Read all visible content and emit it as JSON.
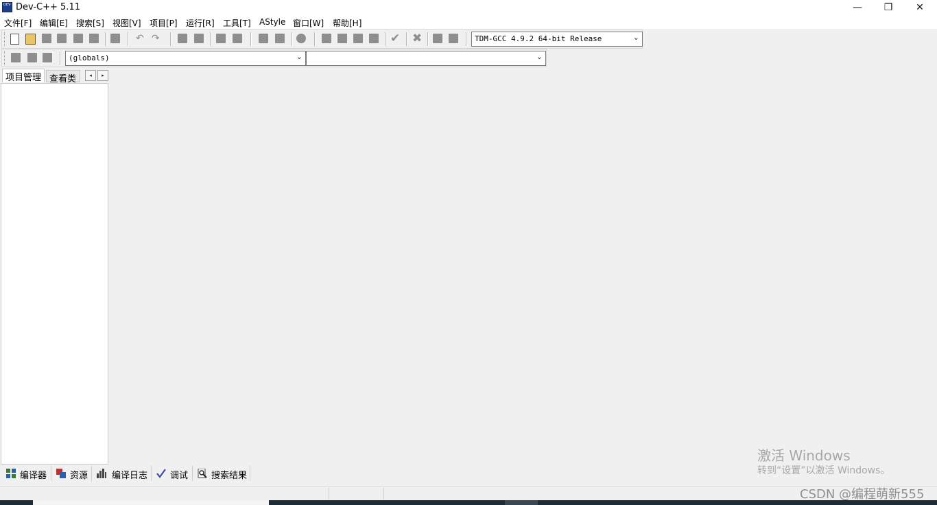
{
  "window": {
    "title": "Dev-C++ 5.11",
    "icon_label": "DEV",
    "minimize_glyph": "—",
    "restore_glyph": "❐",
    "close_glyph": "✕"
  },
  "menu": [
    {
      "label": "文件[F]"
    },
    {
      "label": "编辑[E]"
    },
    {
      "label": "搜索[S]"
    },
    {
      "label": "视图[V]"
    },
    {
      "label": "项目[P]"
    },
    {
      "label": "运行[R]"
    },
    {
      "label": "工具[T]"
    },
    {
      "label": "AStyle"
    },
    {
      "label": "窗口[W]"
    },
    {
      "label": "帮助[H]"
    }
  ],
  "toolbar": {
    "compiler_select": "TDM-GCC 4.9.2 64-bit Release",
    "scope_select": "(globals)",
    "function_select": ""
  },
  "left_panel": {
    "tabs": [
      "项目管理",
      "查看类"
    ],
    "scroll_left": "◂",
    "scroll_right": "▸"
  },
  "bottom_tabs": [
    {
      "label": "编译器",
      "icon": "compiler-grid-icon"
    },
    {
      "label": "资源",
      "icon": "resources-icon"
    },
    {
      "label": "编译日志",
      "icon": "bar-chart-icon"
    },
    {
      "label": "调试",
      "icon": "checkmark-icon"
    },
    {
      "label": "搜索结果",
      "icon": "magnifier-doc-icon"
    }
  ],
  "watermark": {
    "title": "激活 Windows",
    "subtitle": "转到“设置”以激活 Windows。"
  },
  "overlay_text": "CSDN @编程萌新555",
  "colors": {
    "background": "#f0f0f0",
    "panel": "#ffffff"
  }
}
